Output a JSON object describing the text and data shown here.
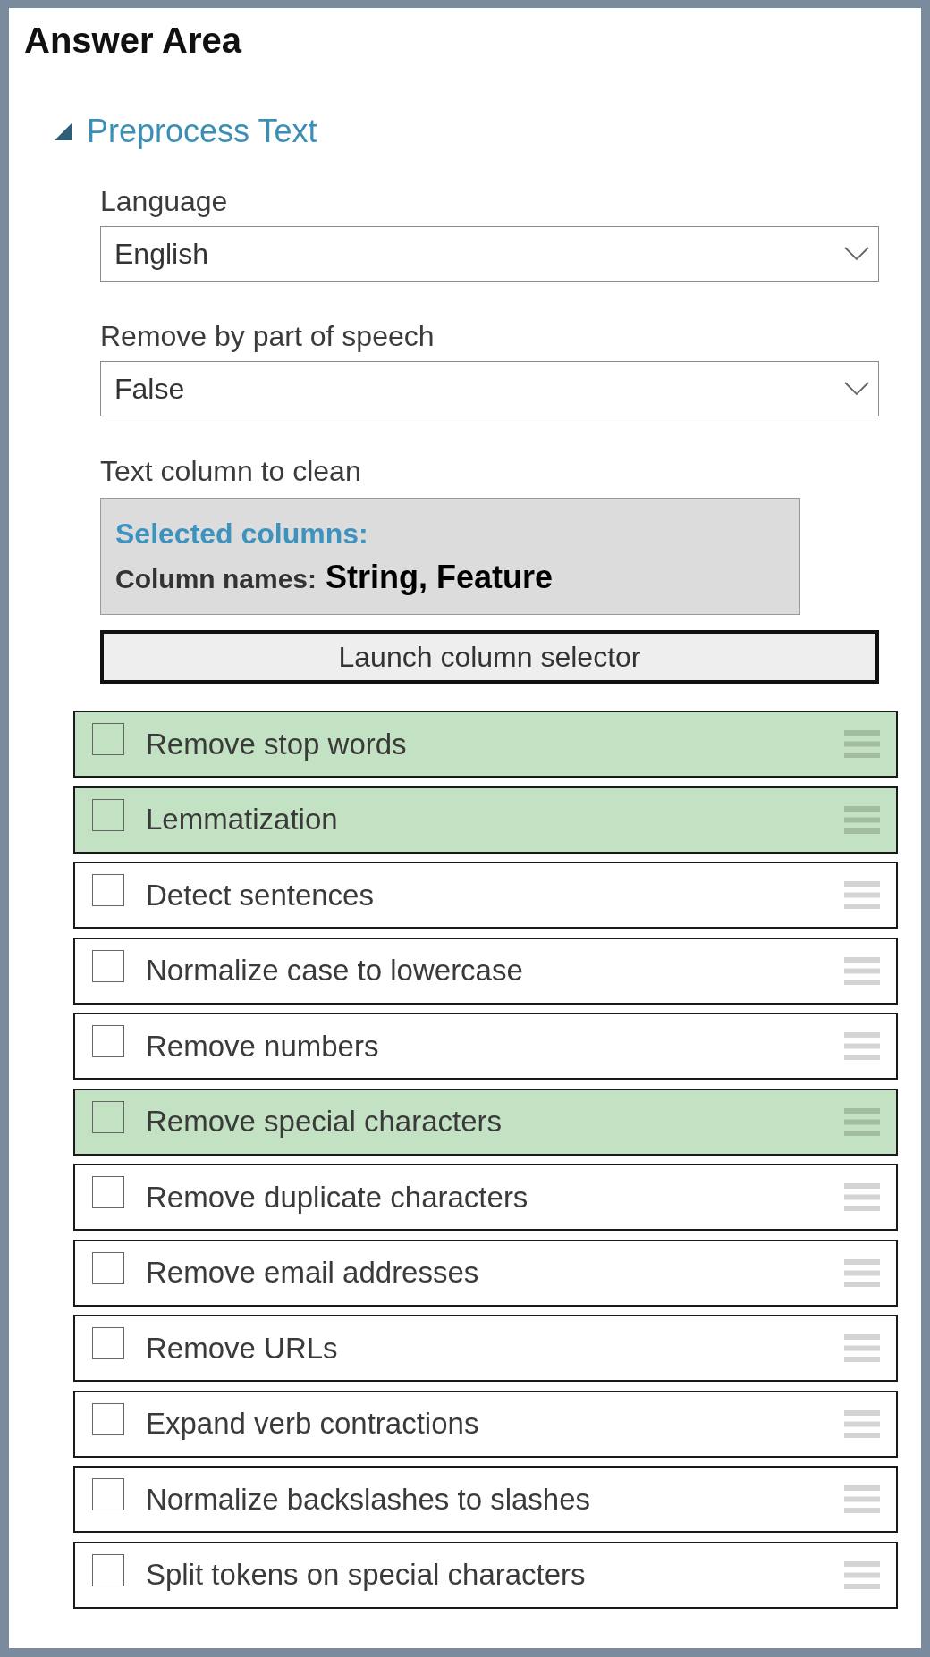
{
  "title": "Answer Area",
  "section": {
    "title": "Preprocess Text",
    "expanded": true
  },
  "fields": [
    {
      "label": "Language",
      "kind": "dropdown",
      "value": "English"
    },
    {
      "label": "Remove by part of speech",
      "kind": "dropdown",
      "value": "False"
    }
  ],
  "column_picker": {
    "label": "Text column to clean",
    "heading": "Selected columns:",
    "names_label": "Column names:",
    "names": "String, Feature",
    "button": "Launch column selector"
  },
  "options": [
    {
      "label": "Remove stop words",
      "checked": false,
      "selected": true
    },
    {
      "label": "Lemmatization",
      "checked": false,
      "selected": true
    },
    {
      "label": "Detect sentences",
      "checked": false,
      "selected": false
    },
    {
      "label": "Normalize case to lowercase",
      "checked": false,
      "selected": false
    },
    {
      "label": "Remove numbers",
      "checked": false,
      "selected": false
    },
    {
      "label": "Remove special characters",
      "checked": false,
      "selected": true
    },
    {
      "label": "Remove duplicate characters",
      "checked": false,
      "selected": false
    },
    {
      "label": "Remove email addresses",
      "checked": false,
      "selected": false
    },
    {
      "label": "Remove URLs",
      "checked": false,
      "selected": false
    },
    {
      "label": "Expand verb contractions",
      "checked": false,
      "selected": false
    },
    {
      "label": "Normalize backslashes to slashes",
      "checked": false,
      "selected": false
    },
    {
      "label": "Split tokens on special characters",
      "checked": false,
      "selected": false
    }
  ]
}
